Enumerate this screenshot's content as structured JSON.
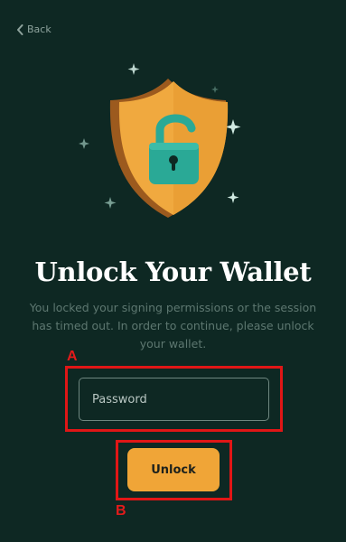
{
  "nav": {
    "back_label": "Back"
  },
  "page": {
    "title": "Unlock Your Wallet",
    "description": "You locked your signing permissions or the session has timed out. In order to continue, please unlock your wallet."
  },
  "form": {
    "password_placeholder": "Password",
    "password_value": "",
    "unlock_label": "Unlock"
  },
  "annotations": {
    "a": "A",
    "b": "B"
  },
  "colors": {
    "background": "#0e2823",
    "accent": "#f0a537",
    "lock": "#2aa996",
    "highlight": "#e01616"
  },
  "icons": {
    "back": "chevron-left-icon",
    "hero": "shield-unlocked-padlock-illustration"
  }
}
